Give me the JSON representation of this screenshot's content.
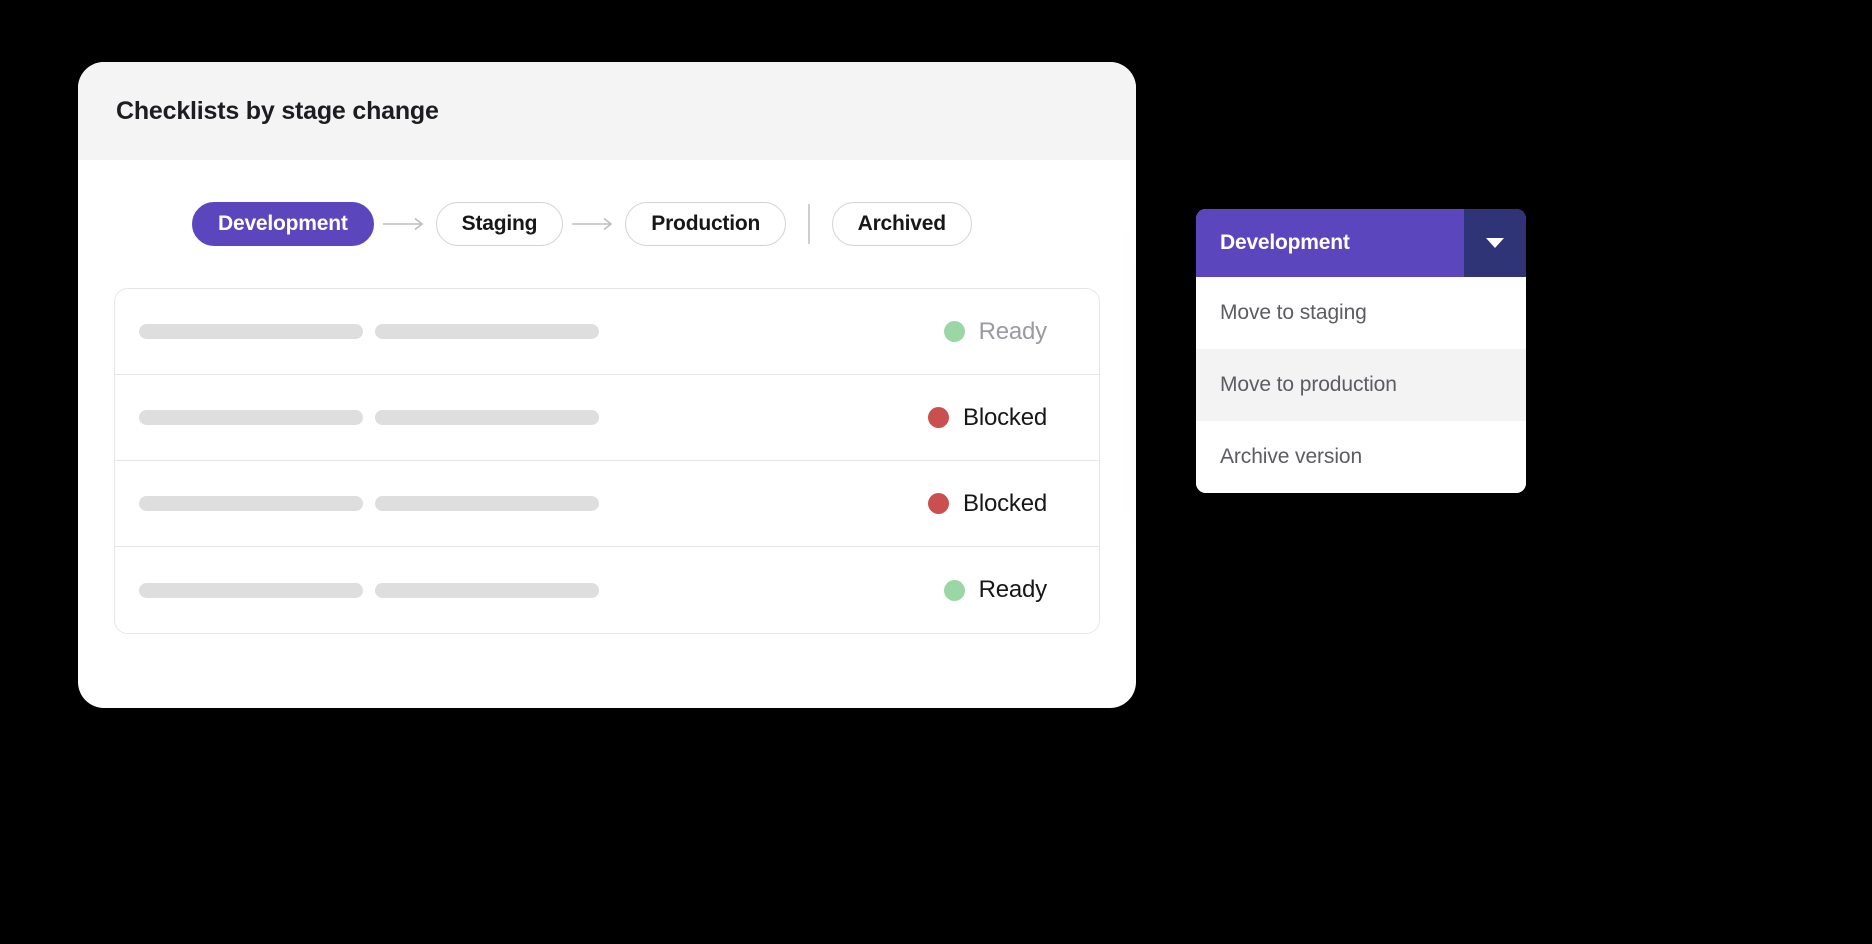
{
  "card": {
    "title": "Checklists by stage change"
  },
  "stages": {
    "items": [
      {
        "label": "Development",
        "state": "active"
      },
      {
        "label": "Staging",
        "state": "inactive"
      },
      {
        "label": "Production",
        "state": "inactive"
      },
      {
        "label": "Archived",
        "state": "inactive"
      }
    ],
    "arrow_glyph": "→",
    "active_color": "#5b46bd"
  },
  "table": {
    "rows": [
      {
        "status_label": "Ready",
        "status_color": "#9bd7a5",
        "text_color": "#9a9aa0"
      },
      {
        "status_label": "Blocked",
        "status_color": "#c9504f",
        "text_color": "#17171a"
      },
      {
        "status_label": "Blocked",
        "status_color": "#c9504f",
        "text_color": "#17171a"
      },
      {
        "status_label": "Ready",
        "status_color": "#9bd7a5",
        "text_color": "#17171a"
      }
    ]
  },
  "dropdown": {
    "selected": "Development",
    "caret_icon": "chevron-down-icon",
    "header_color": "#5b46bd",
    "caret_button_color": "#2f3476",
    "items": [
      {
        "label": "Move to staging",
        "highlighted": false
      },
      {
        "label": "Move to production",
        "highlighted": true
      },
      {
        "label": "Archive version",
        "highlighted": false
      }
    ]
  }
}
